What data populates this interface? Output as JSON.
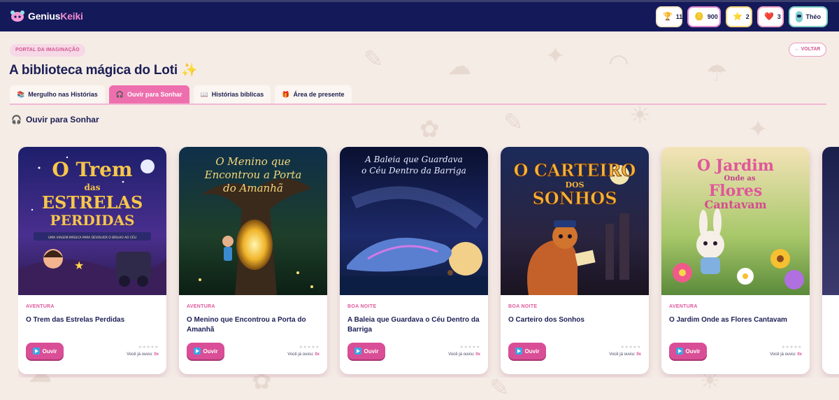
{
  "header": {
    "logo_text_a": "Genius",
    "logo_text_b": "Keiki",
    "stats": {
      "trophies": "11",
      "coins": "900",
      "stars": "2",
      "hearts": "3",
      "profile_name": "Théo"
    },
    "colors": {
      "background": "#14195a",
      "accent": "#f08bd0"
    }
  },
  "page": {
    "portal_badge": "PORTAL DA IMAGINAÇÃO",
    "back_label": "← VOLTAR",
    "title": "A biblioteca mágica do Loti",
    "title_emoji": "✨"
  },
  "tabs": [
    {
      "icon": "📚",
      "label": "Mergulho nas Histórias",
      "active": false
    },
    {
      "icon": "🎧",
      "label": "Ouvir para Sonhar",
      "active": true
    },
    {
      "icon": "📖",
      "label": "Histórias bíblicas",
      "active": false
    },
    {
      "icon": "🎁",
      "label": "Área de presente",
      "active": false
    }
  ],
  "section": {
    "icon": "🎧",
    "title": "Ouvir para Sonhar"
  },
  "cards": [
    {
      "category": "AVENTURA",
      "title": "O Trem das Estrelas Perdidas",
      "cover_line1": "O Trem",
      "cover_line2": "das",
      "cover_line3": "ESTRELAS",
      "cover_line4": "PERDIDAS",
      "cover_sub": "UMA VIAGEM MÁGICA PARA DEVOLVER O BRILHO AO CÉU",
      "listen_label": "Ouvir",
      "stars": "★★★★★",
      "played_label": "Você já ouviu:",
      "played_count": "0x"
    },
    {
      "category": "AVENTURA",
      "title": "O Menino que Encontrou a Porta do Amanhã",
      "cover_line1": "O Menino que",
      "cover_line2": "Encontrou a Porta",
      "cover_line3": "do Amanhã",
      "listen_label": "Ouvir",
      "stars": "★★★★★",
      "played_label": "Você já ouviu:",
      "played_count": "0x"
    },
    {
      "category": "BOA NOITE",
      "title": "A Baleia que Guardava o Céu Dentro da Barriga",
      "cover_line1": "A Baleia que Guardava",
      "cover_line2": "o Céu Dentro da Barriga",
      "listen_label": "Ouvir",
      "stars": "★★★★★",
      "played_label": "Você já ouviu:",
      "played_count": "0x"
    },
    {
      "category": "BOA NOITE",
      "title": "O Carteiro dos Sonhos",
      "cover_line1": "O CARTEIRO",
      "cover_line2": "DOS",
      "cover_line3": "SONHOS",
      "listen_label": "Ouvir",
      "stars": "★★★★★",
      "played_label": "Você já ouviu:",
      "played_count": "0x"
    },
    {
      "category": "AVENTURA",
      "title": "O Jardim Onde as Flores Cantavam",
      "cover_line1": "O Jardim",
      "cover_line2": "Onde as",
      "cover_line3": "Flores",
      "cover_line4": "Cantavam",
      "listen_label": "Ouvir",
      "stars": "★★★★★",
      "played_label": "Você já ouviu:",
      "played_count": "0x"
    }
  ]
}
